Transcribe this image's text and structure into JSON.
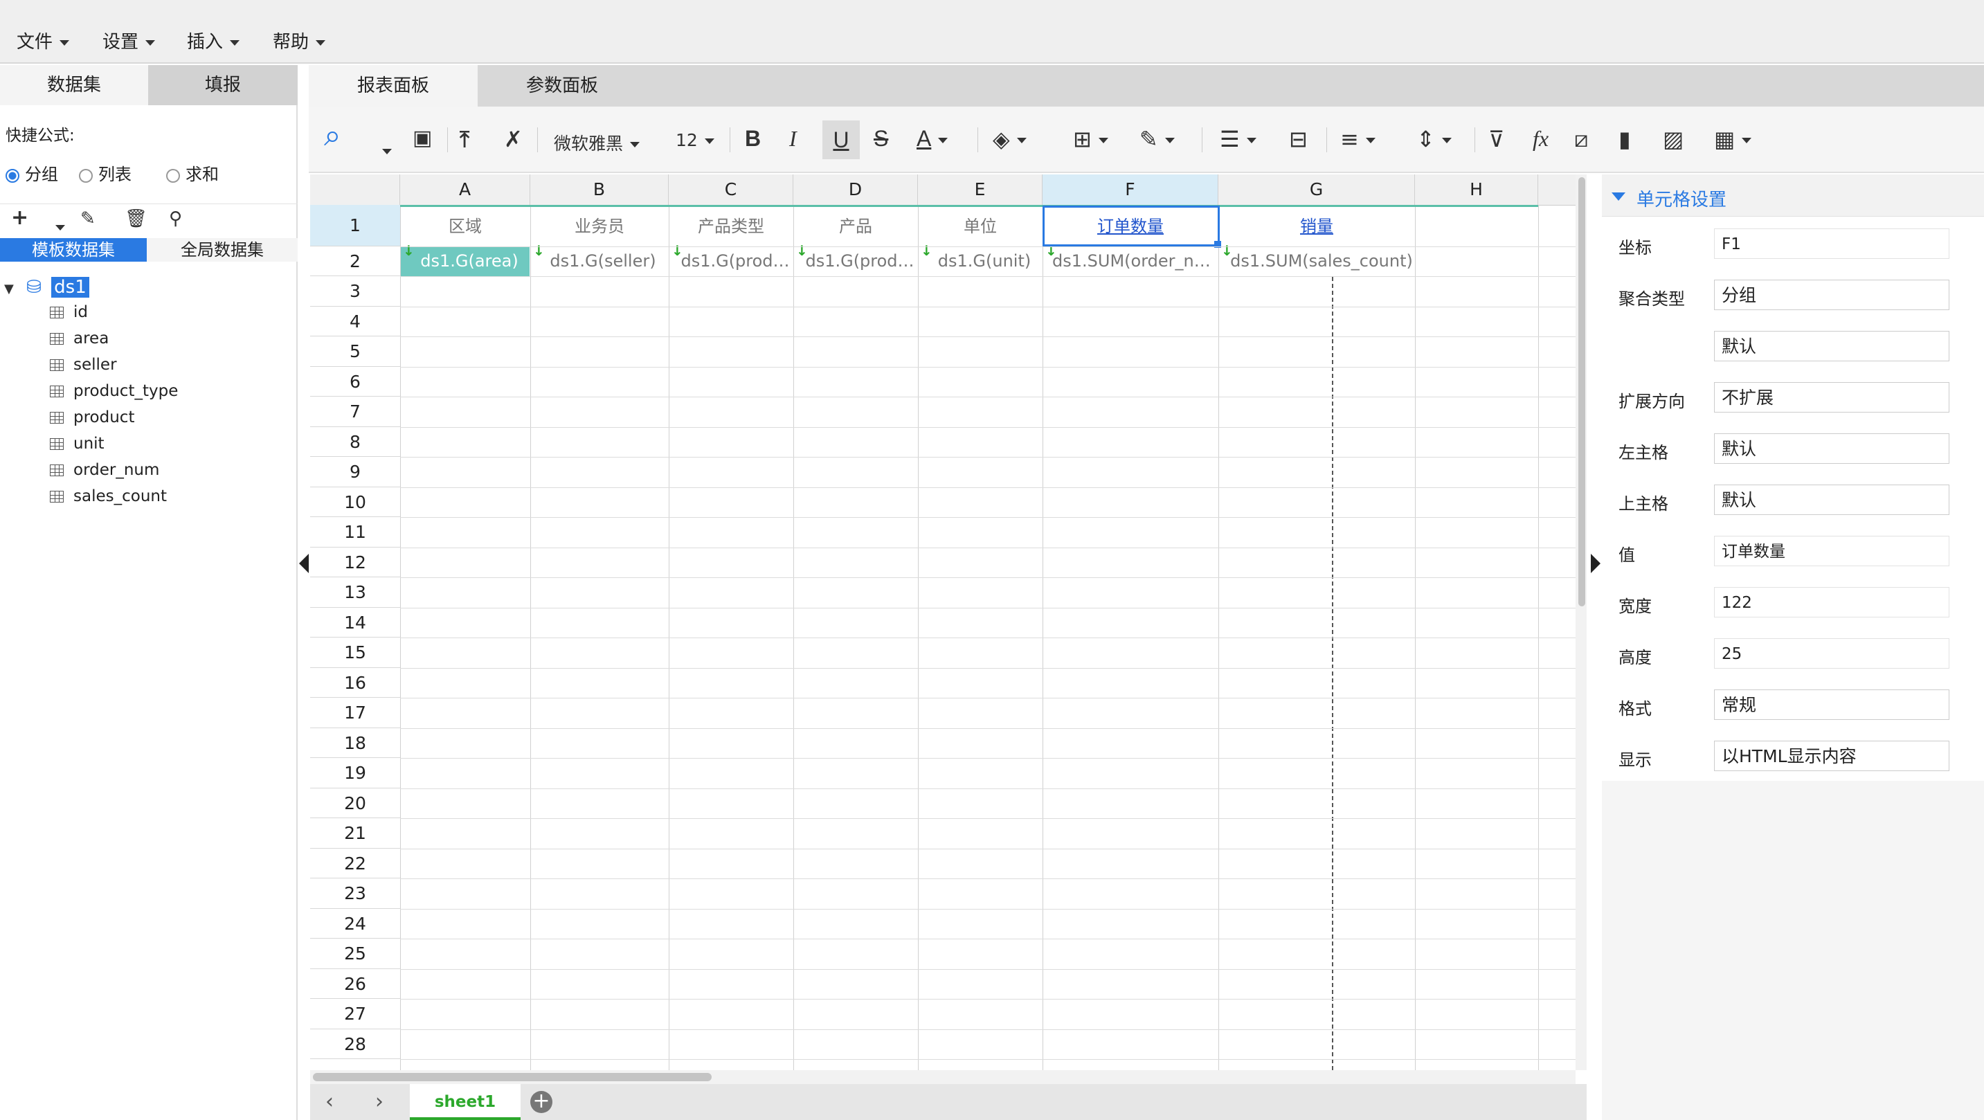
{
  "menubar": {
    "items": [
      "文件",
      "设置",
      "插入",
      "帮助"
    ]
  },
  "left_panel": {
    "tabs": [
      "数据集",
      "填报"
    ],
    "quick_formula_label": "快捷公式:",
    "radios": [
      {
        "label": "分组",
        "checked": true
      },
      {
        "label": "列表",
        "checked": false
      },
      {
        "label": "求和",
        "checked": false
      }
    ],
    "subtabs": [
      "模板数据集",
      "全局数据集"
    ],
    "tree": {
      "root": "ds1",
      "fields": [
        "id",
        "area",
        "seller",
        "product_type",
        "product",
        "unit",
        "order_num",
        "sales_count"
      ]
    }
  },
  "center": {
    "tabs": [
      "报表面板",
      "参数面板"
    ],
    "toolbar": {
      "font_family": "微软雅黑",
      "font_size": "12"
    }
  },
  "sheet": {
    "columns": [
      "A",
      "B",
      "C",
      "D",
      "E",
      "F",
      "G",
      "H"
    ],
    "active_column": "F",
    "rows": [
      "1",
      "2",
      "3",
      "4",
      "5",
      "6",
      "7",
      "8",
      "9",
      "10",
      "11",
      "12",
      "13",
      "14",
      "15",
      "16",
      "17",
      "18",
      "19",
      "20",
      "21",
      "22",
      "23",
      "24",
      "25",
      "26",
      "27",
      "28"
    ],
    "active_row": "1",
    "row1": [
      "区域",
      "业务员",
      "产品类型",
      "产品",
      "单位",
      "订单数量",
      "销量",
      ""
    ],
    "row2": [
      "ds1.G(area)",
      "ds1.G(seller)",
      "ds1.G(prod…",
      "ds1.G(prod…",
      "ds1.G(unit)",
      "ds1.SUM(order_nu…",
      "ds1.SUM(sales_count)",
      ""
    ],
    "tab_name": "sheet1"
  },
  "right_panel": {
    "title": "单元格设置",
    "props": [
      {
        "label": "坐标",
        "value": "F1"
      },
      {
        "label": "聚合类型",
        "value": "分组"
      },
      {
        "label": "",
        "value": "默认"
      },
      {
        "label": "扩展方向",
        "value": "不扩展"
      },
      {
        "label": "左主格",
        "value": "默认"
      },
      {
        "label": "上主格",
        "value": "默认"
      },
      {
        "label": "值",
        "value": "订单数量"
      },
      {
        "label": "宽度",
        "value": "122"
      },
      {
        "label": "高度",
        "value": "25"
      },
      {
        "label": "格式",
        "value": "常规"
      },
      {
        "label": "显示",
        "value": "以HTML显示内容"
      }
    ]
  },
  "colors": {
    "accent": "#2a7ae2",
    "teal_cell": "#6fc9c0",
    "expand_arrow": "#2ca82c"
  }
}
